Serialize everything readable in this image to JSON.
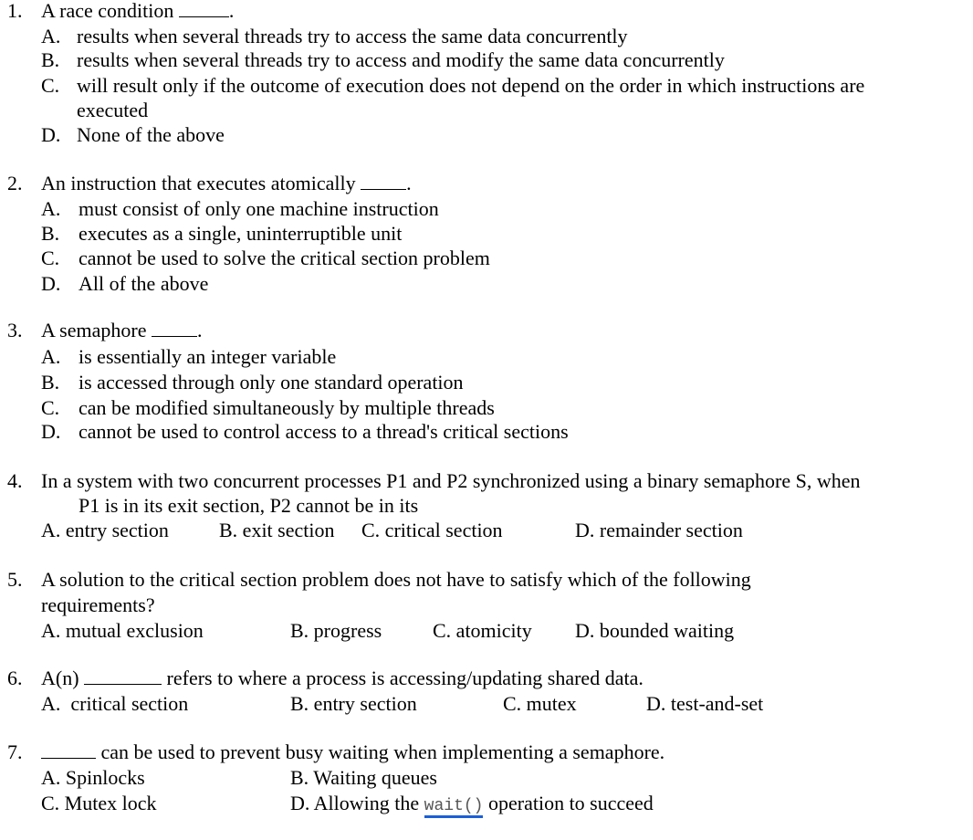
{
  "questions": [
    {
      "number": "1.",
      "stem": [
        {
          "t": "A race condition "
        },
        {
          "blank": 55
        },
        {
          "t": "."
        }
      ],
      "options": [
        {
          "letter": "A.",
          "text": "results when several threads try to access the same data concurrently"
        },
        {
          "letter": "B.",
          "text": "results when several threads try to access and modify the same data concurrently"
        },
        {
          "letter": "C.",
          "text": "will result only if the outcome of execution does not depend on the order in which instructions are"
        },
        {
          "letter": "",
          "text": "executed"
        },
        {
          "letter": "D.",
          "text": "None of the above"
        }
      ]
    },
    {
      "number": "2.",
      "stem": [
        {
          "t": "An instruction that executes atomically "
        },
        {
          "blank": 50
        },
        {
          "t": "."
        }
      ],
      "options": [
        {
          "letter": "A.",
          "text": "must consist of only one machine instruction"
        },
        {
          "letter": "B.",
          "text": "executes as a single, uninterruptible unit"
        },
        {
          "letter": "C.",
          "text": "cannot be used to solve the critical section problem"
        },
        {
          "letter": "D.",
          "text": "All of the above"
        }
      ]
    },
    {
      "number": "3.",
      "stem": [
        {
          "t": "A semaphore "
        },
        {
          "blank": 50
        },
        {
          "t": "."
        }
      ],
      "options": [
        {
          "letter": "A.",
          "text": "is essentially an integer variable"
        },
        {
          "letter": "B.",
          "text": "is accessed through only one standard operation"
        },
        {
          "letter": "C.",
          "text": "can be modified simultaneously by multiple threads"
        },
        {
          "letter": "D.",
          "text": "cannot be used to control access to a thread's critical sections"
        }
      ]
    },
    {
      "number": "4.",
      "stem": [
        {
          "t": "In a system with two concurrent processes P1 and P2 synchronized using a binary semaphore S, when"
        }
      ],
      "stem_cont": "P1 is in its exit section, P2 cannot be in its",
      "inline_options": [
        "A. entry section",
        "B. exit section",
        "C. critical section",
        "D. remainder section"
      ]
    },
    {
      "number": "5.",
      "stem": [
        {
          "t": "A solution to the critical section problem does not have to satisfy which of the following"
        }
      ],
      "stem_cont": "requirements?",
      "inline_options": [
        "A. mutual exclusion",
        "B. progress",
        "C. atomicity",
        "D. bounded waiting"
      ]
    },
    {
      "number": "6.",
      "stem": [
        {
          "t": "A(n) "
        },
        {
          "blank": 85
        },
        {
          "t": " refers to where a process is accessing/updating shared data."
        }
      ],
      "inline_options": [
        "A.  critical section",
        "B. entry section",
        "C. mutex",
        "D. test-and-set"
      ]
    },
    {
      "number": "7.",
      "stem": [
        {
          "blank": 60
        },
        {
          "t": " can be used to prevent busy waiting when implementing a semaphore."
        }
      ],
      "grid_options": [
        "A. Spinlocks",
        "B. Waiting queues",
        "C. Mutex lock",
        "D. Allowing the "
      ],
      "code_text": "wait()",
      "code_after": " operation to succeed"
    }
  ]
}
